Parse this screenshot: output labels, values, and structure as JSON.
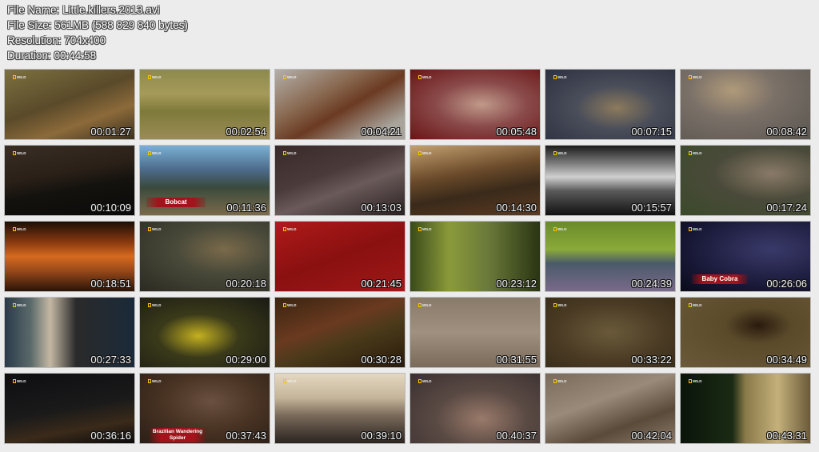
{
  "info": {
    "file_name": "File Name: Little.killers.2013.avi",
    "file_size": "File Size: 561MB (588 829 840 bytes)",
    "resolution": "Resolution: 704x400",
    "duration": "Duration: 00:44:58"
  },
  "channel_logo": "WILD",
  "thumbnails": [
    {
      "time": "00:01:27",
      "bg": "linear-gradient(160deg,#7c7140 0%,#5a4a2a 45%,#8c6a3a 70%,#3a301e 100%)"
    },
    {
      "time": "00:02:54",
      "bg": "linear-gradient(180deg,#8c8a4c 0%,#a69a5a 35%,#7e7a3a 60%,#9a8c56 100%)"
    },
    {
      "time": "00:04:21",
      "bg": "linear-gradient(150deg,#b4b0aa 0%,#8a6a52 35%,#6b3a22 55%,#a8a49c 85%)"
    },
    {
      "time": "00:05:48",
      "bg": "radial-gradient(ellipse at 55% 50%,#c09a8a 0%,#8a4a4a 45%,#6a1414 100%)"
    },
    {
      "time": "00:07:15",
      "bg": "radial-gradient(ellipse at 55% 55%,#8c7a5c 0%,#4a4e5a 40%,#2c3040 100%)"
    },
    {
      "time": "00:08:42",
      "bg": "radial-gradient(ellipse at 40% 30%,#b09a7a 0%,#7a7068 40%,#5a5650 100%)"
    },
    {
      "time": "00:10:09",
      "bg": "linear-gradient(170deg,#3a2e24 0%,#2a2018 40%,#14120e 60%,#0a0a0a 100%)"
    },
    {
      "time": "00:11:36",
      "bg": "linear-gradient(180deg,#7ab0d4 0%,#4c6a8a 35%,#3a4a3c 60%,#7a6a4a 100%)",
      "caption": "Bobcat"
    },
    {
      "time": "00:13:03",
      "bg": "linear-gradient(160deg,#3a2a2a 0%,#4a3a3a 40%,#6a5a5a 60%,#2a2020 100%)"
    },
    {
      "time": "00:14:30",
      "bg": "linear-gradient(170deg,#c4a070 0%,#6a4a2a 40%,#3a2a1a 65%,#5a3a22 100%)"
    },
    {
      "time": "00:15:57",
      "bg": "linear-gradient(180deg,#1a1a1a 0%,#7a7a7a 25%,#d0d0d0 45%,#5a5a5a 65%,#111 100%)"
    },
    {
      "time": "00:17:24",
      "bg": "radial-gradient(ellipse at 70% 40%,#8a7a68 0%,#4a4a3a 45%,#3a4a2a 100%)"
    },
    {
      "time": "00:18:51",
      "bg": "linear-gradient(180deg,#1a0e06 0%,#8a3a10 30%,#d46a20 50%,#9a4a1a 70%,#2a1408 100%)"
    },
    {
      "time": "00:20:18",
      "bg": "radial-gradient(ellipse at 65% 40%,#7a6a4a 0%,#4a4a3a 40%,#2a2a22 100%)"
    },
    {
      "time": "00:21:45",
      "bg": "linear-gradient(160deg,#b01a1a 0%,#8a1010 50%,#a01818 100%)"
    },
    {
      "time": "00:23:12",
      "bg": "linear-gradient(90deg,#3a4a1a 0%,#8a9a3a 30%,#6a7a3a 60%,#2a3412 100%)"
    },
    {
      "time": "00:24:39",
      "bg": "linear-gradient(180deg,#6a8a2a 0%,#8aaa3a 40%,#4a5a6a 60%,#7a6a8a 100%)"
    },
    {
      "time": "00:26:06",
      "bg": "radial-gradient(ellipse at 70% 40%,#3a3a6a 0%,#1a1a3a 60%,#0a0a1a 100%)",
      "caption": "Baby Cobra"
    },
    {
      "time": "00:27:33",
      "bg": "linear-gradient(90deg,#2a3a4a 0%,#5a6a6a 20%,#c4b8a4 35%,#2a2a2a 55%,#1a2a3a 100%)"
    },
    {
      "time": "00:29:00",
      "bg": "radial-gradient(ellipse at 45% 55%,#c4b020 0%,#3a3a1a 40%,#1a1a14 100%)"
    },
    {
      "time": "00:30:28",
      "bg": "linear-gradient(160deg,#3a2410 0%,#6a3a20 40%,#4a3a1a 60%,#2a1a0a 100%)"
    },
    {
      "time": "00:31:55",
      "bg": "linear-gradient(180deg,#8a7a6a 0%,#a09080 50%,#7a6a5a 100%)"
    },
    {
      "time": "00:33:22",
      "bg": "radial-gradient(ellipse at 50% 50%,#6a5a3a 0%,#4a3a24 60%,#3a2e1a 100%)"
    },
    {
      "time": "00:34:49",
      "bg": "radial-gradient(ellipse at 60% 40%,#2a1a0e 0%,#5a4a2a 30%,#6a5a3a 100%)"
    },
    {
      "time": "00:36:16",
      "bg": "linear-gradient(170deg,#0e0e12 0%,#1a1a1a 50%,#3a2a1a 75%,#0a0a0a 100%)"
    },
    {
      "time": "00:37:43",
      "bg": "radial-gradient(ellipse at 55% 40%,#6a5040 0%,#4a3424 45%,#2a1e16 100%)",
      "caption": "Brazilian Wandering Spider"
    },
    {
      "time": "00:39:10",
      "bg": "linear-gradient(180deg,#e4d8c0 0%,#c4b49a 35%,#7a6a5a 60%,#2a2420 100%)"
    },
    {
      "time": "00:40:37",
      "bg": "radial-gradient(ellipse at 55% 65%,#9a7a6a 0%,#5a4a44 45%,#3a3030 100%)"
    },
    {
      "time": "00:42:04",
      "bg": "linear-gradient(160deg,#7a6a5a 0%,#9a8a7a 40%,#5a4a3a 70%,#8a7a6a 100%)"
    },
    {
      "time": "00:43:31",
      "bg": "linear-gradient(90deg,#0a140a 0%,#1a2a14 40%,#8a7a4a 50%,#c4b07a 75%,#6a5a3a 100%)"
    }
  ]
}
